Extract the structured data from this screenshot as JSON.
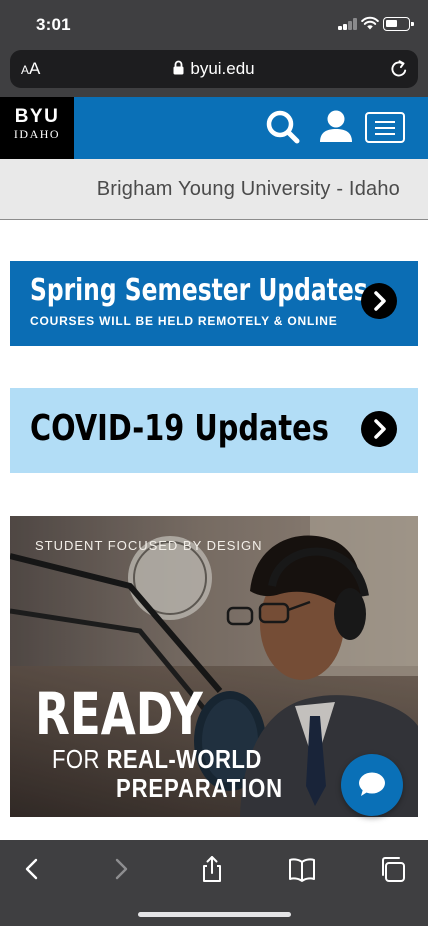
{
  "status_bar": {
    "time": "3:01"
  },
  "browser": {
    "text_size_label_small": "A",
    "text_size_label_large": "A",
    "url": "byui.edu"
  },
  "header": {
    "logo_main": "BYU",
    "logo_sub": "IDAHO",
    "brand_color": "#0a70b7"
  },
  "university_name": "Brigham Young University - Idaho",
  "banners": {
    "spring": {
      "title": "Spring Semester Updates",
      "subtitle": "COURSES WILL BE HELD REMOTELY & ONLINE",
      "color": "#0b6db4"
    },
    "covid": {
      "title": "COVID-19 Updates",
      "color": "#b2ddf6"
    }
  },
  "hero": {
    "tagline": "STUDENT FOCUSED BY DESIGN",
    "headline": "READY",
    "line2_prefix": "FOR",
    "line2_bold": "REAL-WORLD",
    "line3": "PREPARATION"
  }
}
